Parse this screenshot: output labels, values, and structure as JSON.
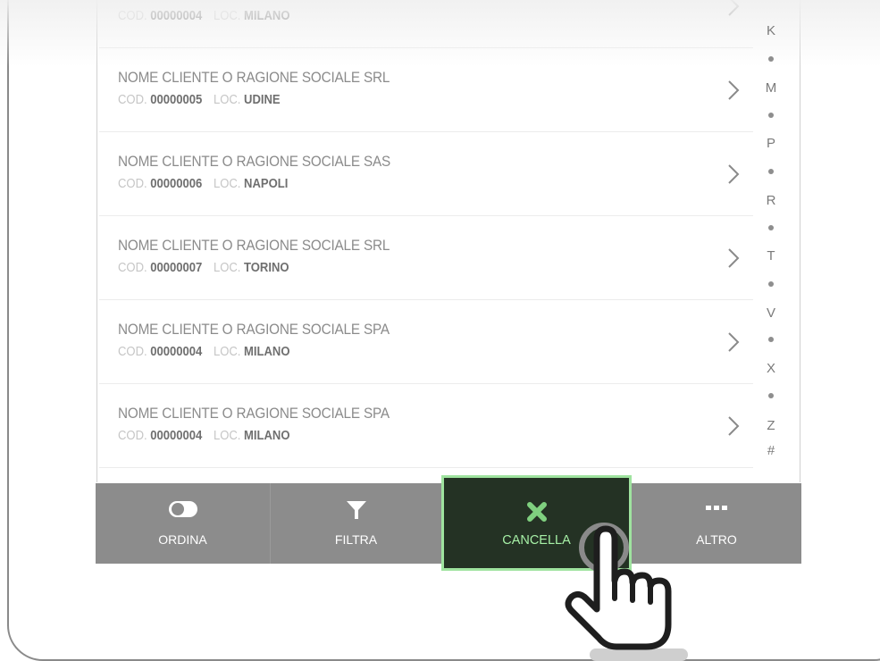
{
  "list": {
    "rows": [
      {
        "name": "",
        "cod_label": "COD.",
        "cod": "00000004",
        "loc_label": "LOC.",
        "loc": "MILANO"
      },
      {
        "name": "NOME CLIENTE O RAGIONE SOCIALE SRL",
        "cod_label": "COD.",
        "cod": "00000005",
        "loc_label": "LOC.",
        "loc": "UDINE"
      },
      {
        "name": "NOME CLIENTE O RAGIONE SOCIALE SAS",
        "cod_label": "COD.",
        "cod": "00000006",
        "loc_label": "LOC.",
        "loc": "NAPOLI"
      },
      {
        "name": "NOME CLIENTE O RAGIONE SOCIALE SRL",
        "cod_label": "COD.",
        "cod": "00000007",
        "loc_label": "LOC.",
        "loc": "TORINO"
      },
      {
        "name": "NOME CLIENTE O RAGIONE SOCIALE SPA",
        "cod_label": "COD.",
        "cod": "00000004",
        "loc_label": "LOC.",
        "loc": "MILANO"
      },
      {
        "name": "NOME CLIENTE O RAGIONE SOCIALE SPA",
        "cod_label": "COD.",
        "cod": "00000004",
        "loc_label": "LOC.",
        "loc": "MILANO"
      }
    ]
  },
  "index": {
    "letters": [
      "K",
      "M",
      "P",
      "R",
      "T",
      "V",
      "X",
      "Z",
      "#"
    ]
  },
  "toolbar": {
    "ordina_label": "ORDINA",
    "filtra_label": "FILTRA",
    "cancella_label": "CANCELLA",
    "altro_label": "ALTRO",
    "icons": [
      "toggle-icon",
      "filter-icon",
      "close-icon",
      "more-icon",
      "pointing-hand-icon"
    ]
  },
  "colors": {
    "toolbar_bg": "#8c8c8c",
    "cancel_bg": "#243224",
    "cancel_accent": "#9fe39f",
    "cancel_icon": "#7fd07f"
  }
}
